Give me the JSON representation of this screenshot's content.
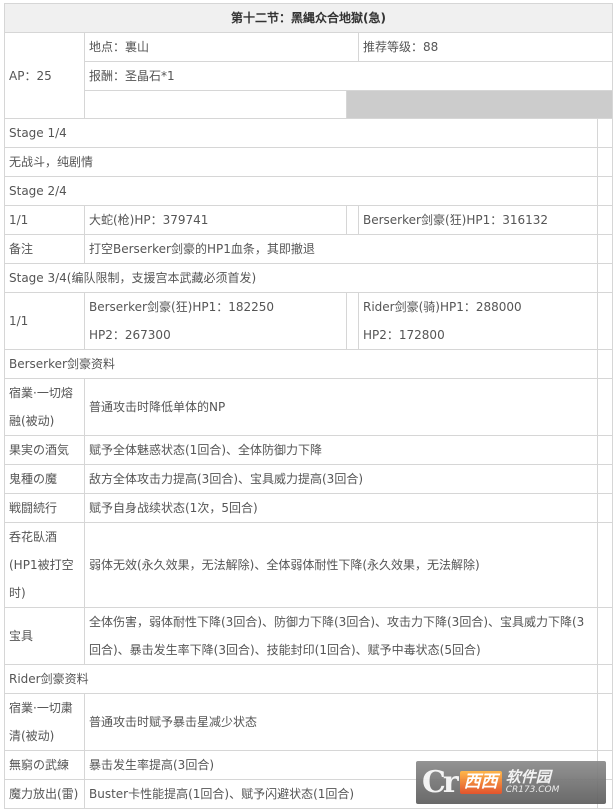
{
  "title": "第十二节：黑縄众合地獄(急)",
  "info": {
    "ap": "AP：25",
    "location": "地点：裏山",
    "recommended_level": "推荐等级：88",
    "reward": "报酬：圣晶石*1"
  },
  "stages": [
    {
      "header": "Stage 1/4",
      "note": "无战斗，纯剧情"
    },
    {
      "header": "Stage 2/4",
      "wave": "1/1",
      "enemies": [
        "大蛇(枪)HP：379741",
        "Berserker剑豪(狂)HP1：316132"
      ],
      "remark_label": "备注",
      "remark": "打空Berserker剑豪的HP1血条，其即撤退"
    },
    {
      "header": "Stage 3/4(编队限制，支援宫本武藏必须首发)",
      "wave": "1/1",
      "enemies": [
        "Berserker剑豪(狂)HP1：182250 HP2：267300",
        "Rider剑豪(骑)HP1：288000 HP2：172800"
      ]
    }
  ],
  "berserker": {
    "header": "Berserker剑豪资料",
    "skills": [
      {
        "name": "宿業·一切熔融(被动)",
        "effect": "普通攻击时降低单体的NP"
      },
      {
        "name": "果実の酒気",
        "effect": "赋予全体魅惑状态(1回合)、全体防御力下降"
      },
      {
        "name": "鬼種の魔",
        "effect": "敌方全体攻击力提高(3回合)、宝具威力提高(3回合)"
      },
      {
        "name": "戦闘続行",
        "effect": "赋予自身战续状态(1次，5回合)"
      },
      {
        "name": "呑花臥酒(HP1被打空时)",
        "effect": "弱体无效(永久效果，无法解除)、全体弱体耐性下降(永久效果，无法解除)"
      },
      {
        "name": "宝具",
        "effect": "全体伤害，弱体耐性下降(3回合)、防御力下降(3回合)、攻击力下降(3回合)、宝具威力下降(3回合)、暴击发生率下降(3回合)、技能封印(1回合)、赋予中毒状态(5回合)"
      }
    ]
  },
  "rider": {
    "header": "Rider剑豪资料",
    "skills": [
      {
        "name": "宿業·一切粛清(被动)",
        "effect": "普通攻击时赋予暴击星减少状态"
      },
      {
        "name": "無窮の武練",
        "effect": "暴击发生率提高(3回合)"
      },
      {
        "name": "魔力放出(雷)",
        "effect": "Buster卡性能提高(1回合)、赋予闪避状态(1回合)"
      }
    ]
  },
  "watermark": {
    "logo": "Cr",
    "brand": "西西",
    "site": "软件园",
    "domain": "CR173.COM"
  }
}
